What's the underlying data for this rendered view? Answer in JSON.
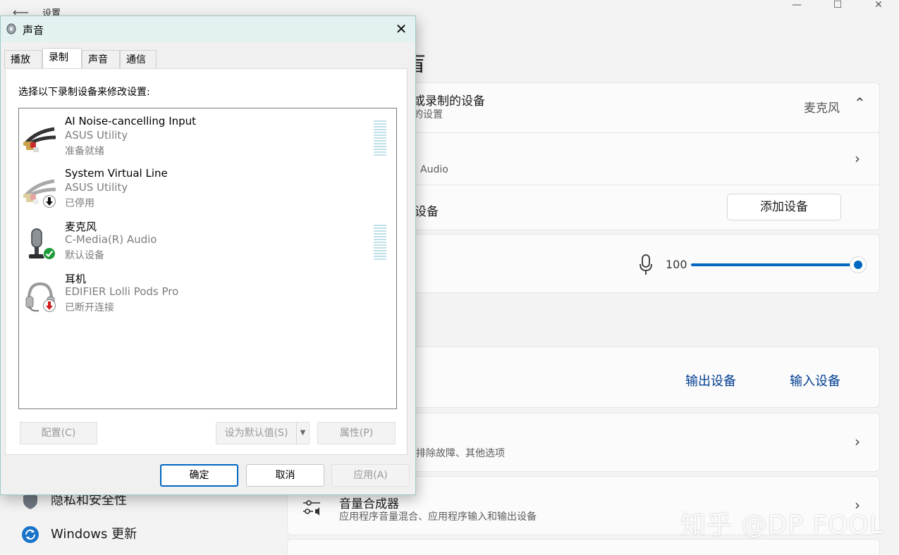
{
  "settings": {
    "title": "设置",
    "heading_fragment": "盲",
    "device_section": {
      "title_fragment": "或录制的设备",
      "subtitle_fragment": "的设置",
      "value": "麦克风"
    },
    "device_row_sub_fragment": "Audio",
    "add_device_row": {
      "label_fragment": "设备",
      "button_label": "添加设备"
    },
    "volume": {
      "value": "100",
      "level_percent": 100
    },
    "links": {
      "output": "输出设备",
      "input": "输入设备"
    },
    "troubleshoot_row": {
      "subtitle_fragment": "排除故障、其他选项"
    },
    "mixer_row": {
      "title": "音量合成器",
      "subtitle": "应用程序音量混合、应用程序输入和输出设备"
    },
    "sidebar": {
      "items": [
        {
          "label": "隐私和安全性",
          "icon": "shield-icon"
        },
        {
          "label": "Windows 更新",
          "icon": "windows-update-icon"
        }
      ]
    },
    "watermark": "知乎 @DP FOOL"
  },
  "dialog": {
    "title": "声音",
    "tabs": [
      {
        "label": "播放",
        "active": false
      },
      {
        "label": "录制",
        "active": true
      },
      {
        "label": "声音",
        "active": false
      },
      {
        "label": "通信",
        "active": false
      }
    ],
    "instruction": "选择以下录制设备来修改设置:",
    "devices": [
      {
        "name": "AI Noise-cancelling Input",
        "provider": "ASUS Utility",
        "status": "准备就绪",
        "icon": "rca-cable-icon",
        "badge": ""
      },
      {
        "name": "System Virtual Line",
        "provider": "ASUS Utility",
        "status": "已停用",
        "icon": "rca-cable-icon",
        "badge": "disabled-arrow-badge-icon"
      },
      {
        "name": "麦克风",
        "provider": "C-Media(R) Audio",
        "status": "默认设备",
        "icon": "microphone-icon",
        "badge": "default-check-badge-icon"
      },
      {
        "name": "耳机",
        "provider": "EDIFIER Lolli Pods Pro",
        "status": "已断开连接",
        "icon": "headset-icon",
        "badge": "disconnected-arrow-badge-icon"
      }
    ],
    "buttons": {
      "configure": "配置(C)",
      "set_default": "设为默认值(S)",
      "properties": "属性(P)",
      "ok": "确定",
      "cancel": "取消",
      "apply": "应用(A)"
    }
  }
}
